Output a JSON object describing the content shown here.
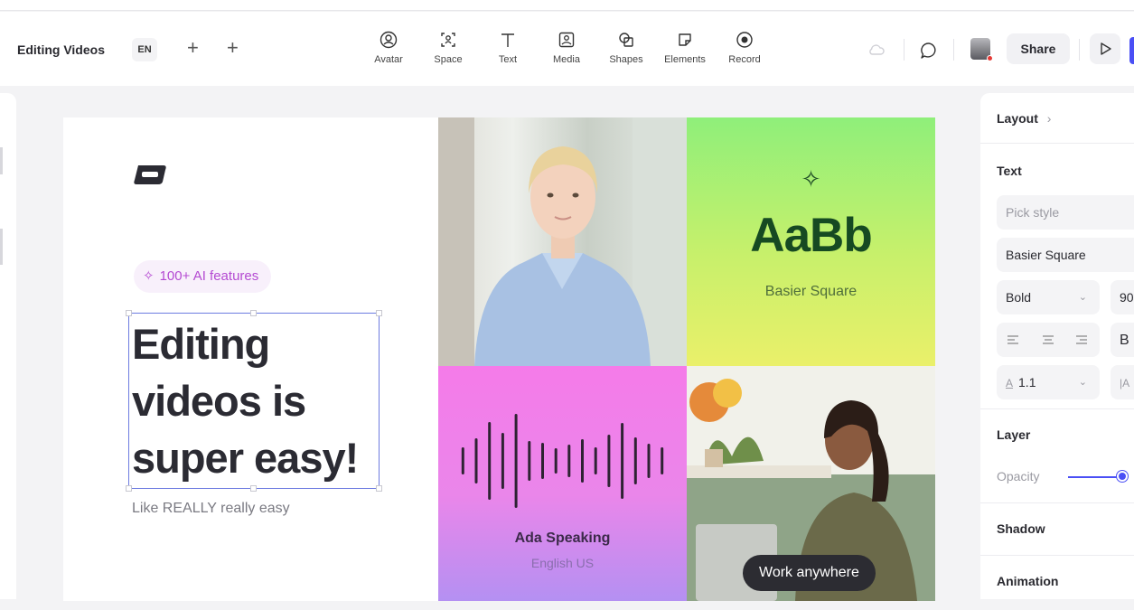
{
  "toolbar": {
    "doc_title": "Editing Videos",
    "language": "EN",
    "tools": [
      {
        "label": "Avatar",
        "icon": "avatar-icon"
      },
      {
        "label": "Space",
        "icon": "space-icon"
      },
      {
        "label": "Text",
        "icon": "text-icon"
      },
      {
        "label": "Media",
        "icon": "media-icon"
      },
      {
        "label": "Shapes",
        "icon": "shapes-icon"
      },
      {
        "label": "Elements",
        "icon": "elements-icon"
      },
      {
        "label": "Record",
        "icon": "record-icon"
      }
    ],
    "share_label": "Share"
  },
  "canvas": {
    "badge": "100+ AI features",
    "headline": [
      "Editing",
      "videos is",
      "super easy!"
    ],
    "subline": "Like REALLY really easy",
    "font_preview": {
      "sample": "AaBb",
      "font_name": "Basier Square"
    },
    "voice": {
      "name": "Ada Speaking",
      "language": "English US"
    },
    "work_label": "Work anywhere"
  },
  "right_panel": {
    "layout_label": "Layout",
    "layout_chevron": "›",
    "text_label": "Text",
    "style_placeholder": "Pick style",
    "font_family": "Basier Square",
    "font_weight": "Bold",
    "font_size": "90",
    "align_extra": "B",
    "line_height": "1.1",
    "letter_spacing": "|A",
    "layer_label": "Layer",
    "opacity_label": "Opacity",
    "opacity_value": 0.95,
    "shadow_label": "Shadow",
    "animation_label": "Animation"
  },
  "colors": {
    "accent": "#4a4ff5",
    "badge_text": "#b44ad2",
    "green_card": "#a8ef73",
    "pink_card": "#f07be8"
  }
}
